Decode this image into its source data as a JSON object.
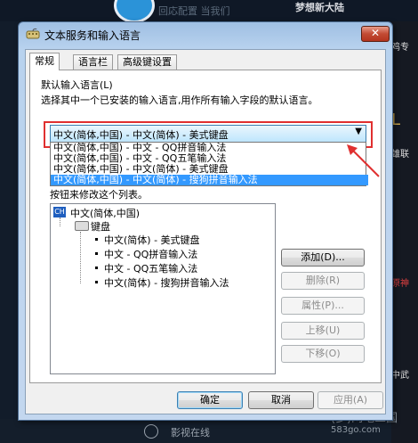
{
  "background": {
    "top_text": "回応配置 当我们",
    "site_title": "梦想新大陆",
    "right_strip": [
      "鸡专",
      "L",
      "雄联",
      "",
      "",
      "原神",
      "",
      "中武"
    ],
    "bottom_text": "影视在线",
    "watermark_line1": "(多)网吧三国",
    "watermark_line2": "583go.com"
  },
  "dialog": {
    "title": "文本服务和输入语言",
    "close_label": "✕",
    "tabs": [
      {
        "label": "常规"
      },
      {
        "label": "语言栏"
      },
      {
        "label": "高级键设置"
      }
    ],
    "default_group_label": "默认输入语言(L)",
    "default_desc": "选择其中一个已安装的输入语言,用作所有输入字段的默认语言。",
    "selected_value": "中文(简体,中国) - 中文(简体) - 美式键盘",
    "dropdown_options": [
      "中文(简体,中国) - 中文 - QQ拼音输入法",
      "中文(简体,中国) - 中文 - QQ五笔输入法",
      "中文(简体,中国) - 中文(简体) - 美式键盘",
      "中文(简体,中国) - 中文(简体) - 搜狗拼音输入法"
    ],
    "dropdown_selected_index": 3,
    "partial_label": "按钮来修改这个列表。",
    "tree": {
      "language": "中文(简体,中国)",
      "language_code": "CH",
      "category": "键盘",
      "items": [
        "中文(简体) - 美式键盘",
        "中文 - QQ拼音输入法",
        "中文 - QQ五笔输入法",
        "中文(简体) - 搜狗拼音输入法"
      ]
    },
    "side_buttons": {
      "add": "添加(D)...",
      "remove": "删除(R)",
      "properties": "属性(P)...",
      "move_up": "上移(U)",
      "move_down": "下移(O)"
    },
    "bottom_buttons": {
      "ok": "确定",
      "cancel": "取消",
      "apply": "应用(A)"
    }
  },
  "colors": {
    "highlight": "#3399ff",
    "annotation_red": "#e03030"
  }
}
